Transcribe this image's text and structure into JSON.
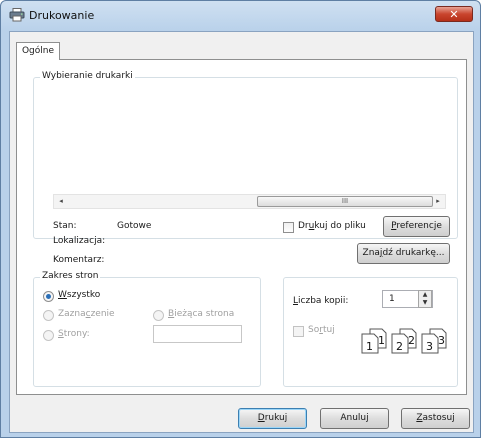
{
  "window": {
    "title": "Drukowanie",
    "close_glyph": "✕"
  },
  "tabs": [
    {
      "label": "Ogólne",
      "active": true
    }
  ],
  "printer_group": {
    "label": "Wybieranie drukarki",
    "scrollbar": {
      "left_arrow": "◂",
      "right_arrow": "▸",
      "grip": "III"
    },
    "status": {
      "label": "Stan:",
      "value": "Gotowe"
    },
    "location": {
      "label": "Lokalizacja:",
      "value": ""
    },
    "comment": {
      "label": "Komentarz:",
      "value": ""
    },
    "print_to_file": {
      "label_pre": "Dr",
      "label_key": "u",
      "label_post": "kuj do pliku",
      "checked": false
    },
    "preferences_button": {
      "label_pre": "",
      "label_key": "P",
      "label_post": "referencje"
    },
    "find_printer_button": {
      "label_pre": "Zna",
      "label_key": "j",
      "label_post": "dź drukarkę..."
    }
  },
  "page_range": {
    "label": "Zakres stron",
    "all": {
      "label_pre": "",
      "label_key": "W",
      "label_post": "szystko",
      "selected": true
    },
    "selection": {
      "label_pre": "Zazna",
      "label_key": "c",
      "label_post": "zenie",
      "enabled": false
    },
    "current_page": {
      "label_pre": "",
      "label_key": "B",
      "label_post": "ieżąca strona",
      "enabled": false
    },
    "pages": {
      "label_pre": "",
      "label_key": "S",
      "label_post": "trony:",
      "enabled": false,
      "value": ""
    }
  },
  "copies": {
    "count_label_pre": "",
    "count_label_key": "L",
    "count_label_post": "iczba kopii:",
    "count_value": "1",
    "collate": {
      "label_pre": "So",
      "label_key": "r",
      "label_post": "tuj",
      "checked": false,
      "enabled": false
    },
    "collate_icons": [
      {
        "front": "1",
        "back": "1"
      },
      {
        "front": "2",
        "back": "2"
      },
      {
        "front": "3",
        "back": "3"
      }
    ]
  },
  "buttons": {
    "print": {
      "label_pre": "",
      "label_key": "D",
      "label_post": "rukuj"
    },
    "cancel": {
      "label": "Anuluj"
    },
    "apply": {
      "label_pre": "",
      "label_key": "Z",
      "label_post": "astosuj"
    }
  },
  "colors": {
    "accent": "#2b6fb7",
    "close": "#c9452e",
    "frame": "#b9d1ea"
  }
}
